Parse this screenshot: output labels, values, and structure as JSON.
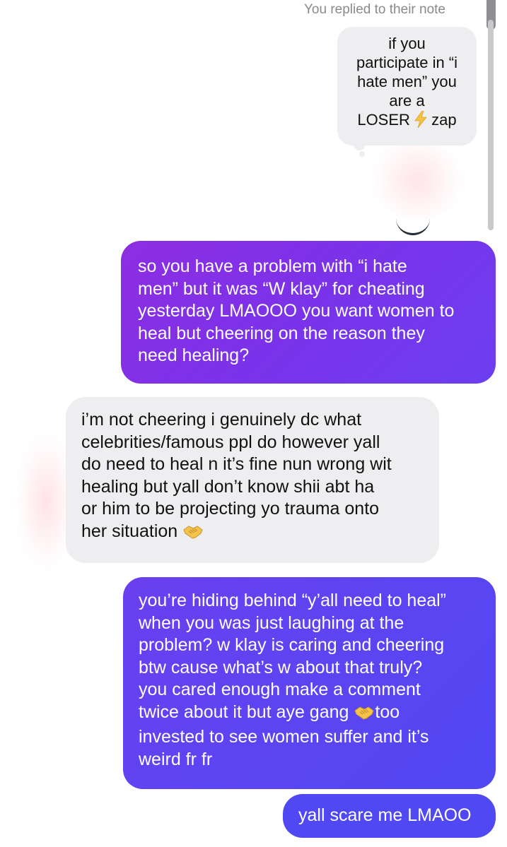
{
  "header": {
    "reply_label": "You replied to their note"
  },
  "note": {
    "text_lines": [
      "if you",
      "participate in “i",
      "hate men” you",
      "are a"
    ],
    "last_line_before_icon": "LOSER",
    "last_line_after_icon": "zap"
  },
  "messages": [
    {
      "side": "outgoing",
      "lines": [
        "so you have a problem with “i hate",
        "men” but it was “W klay” for cheating",
        "yesterday LMAOOO you want women to",
        "heal but cheering on the reason they",
        "need healing?"
      ]
    },
    {
      "side": "incoming",
      "lines": [
        "i’m not cheering i genuinely dc what",
        "celebrities/famous ppl do however yall",
        "do need to heal n it’s fine nun wrong wit",
        "healing but yall don’t know shii abt ha",
        "or him to be projecting yo trauma onto"
      ],
      "last_line": "her situation"
    },
    {
      "side": "outgoing",
      "lines": [
        "you’re hiding behind “y’all need to heal”",
        "when you was just laughing at the",
        "problem? w klay is caring and cheering",
        "btw cause what’s w about that truly?",
        "you cared enough make a comment"
      ],
      "handshake_line_before": "twice about it but aye gang",
      "handshake_line_after": "too",
      "tail_lines": [
        "invested to see women suffer and it’s",
        "weird fr fr"
      ]
    },
    {
      "side": "outgoing",
      "text": "yall scare me LMAOO"
    }
  ],
  "icons": {
    "zap": "lightning-bolt-icon",
    "handshake": "handshake-icon"
  },
  "colors": {
    "incoming_bubble": "#eeeef0",
    "outgoing_purple": "#8e2de2",
    "outgoing_blue": "#5048f3",
    "lightning": "#f6c343"
  }
}
